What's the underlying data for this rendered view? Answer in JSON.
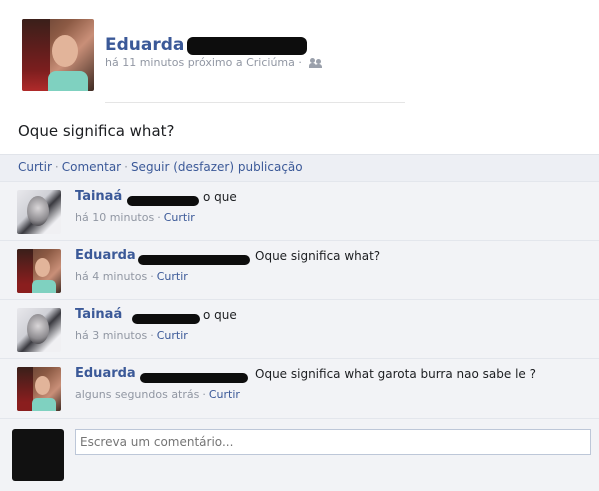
{
  "post": {
    "author": "Eduarda",
    "meta": "há 11 minutos próximo a Criciúma ·",
    "audience_icon": "friends-icon",
    "text": "Oque significa what?"
  },
  "actions": {
    "like": "Curtir",
    "comment": "Comentar",
    "follow": "Seguir (desfazer) publicação",
    "separator": "·"
  },
  "comments": [
    {
      "author": "Tainaá",
      "text": "o que",
      "time": "há 10 minutos",
      "like": "Curtir"
    },
    {
      "author": "Eduarda",
      "text": "Oque significa what?",
      "time": "há 4 minutos",
      "like": "Curtir"
    },
    {
      "author": "Tainaá",
      "text": "o que",
      "time": "há 3 minutos",
      "like": "Curtir"
    },
    {
      "author": "Eduarda",
      "text": "Oque significa what garota burra nao sabe le ?",
      "time": "alguns segundos atrás",
      "like": "Curtir"
    }
  ],
  "composer": {
    "placeholder": "Escreva um comentário..."
  },
  "colors": {
    "link": "#3b5998",
    "panel": "#edeff4",
    "muted": "#9197a3"
  }
}
